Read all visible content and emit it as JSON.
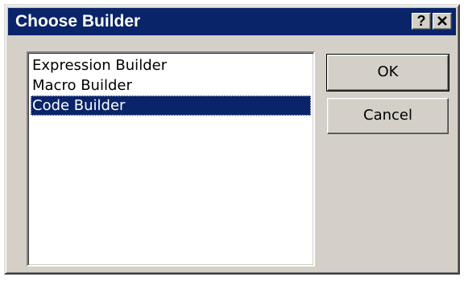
{
  "dialog": {
    "title": "Choose Builder",
    "help_label": "?",
    "close_label": "✕"
  },
  "list": {
    "items": [
      {
        "label": "Expression Builder",
        "selected": false
      },
      {
        "label": "Macro Builder",
        "selected": false
      },
      {
        "label": "Code Builder",
        "selected": true
      }
    ]
  },
  "buttons": {
    "ok_label": "OK",
    "cancel_label": "Cancel"
  },
  "colors": {
    "title_bar": "#0a246a",
    "dialog_face": "#d4d0c8",
    "selection": "#0a246a"
  }
}
